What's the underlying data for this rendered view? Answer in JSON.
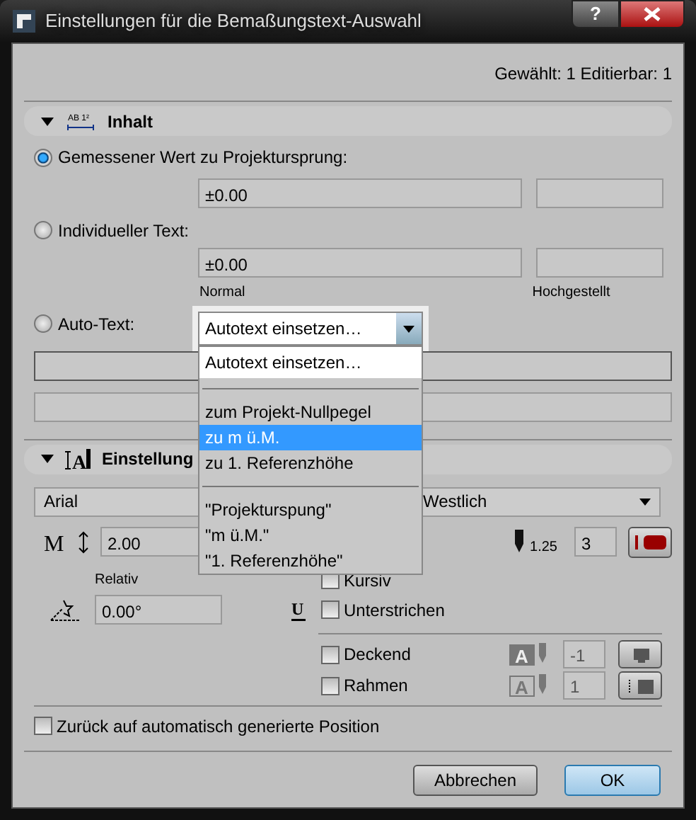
{
  "window": {
    "title": "Einstellungen für die Bemaßungstext-Auswahl",
    "help_button": "?"
  },
  "selection_info": "Gewählt: 1 Editierbar: 1",
  "content_section": {
    "title": "Inhalt",
    "expanded": true,
    "icon_text": "AB 1²"
  },
  "options": [
    {
      "label": "Gemessener Wert zu Projektursprung:",
      "selected": true
    },
    {
      "label": "Individueller Text:",
      "selected": false
    },
    {
      "label": "Auto-Text:",
      "selected": false
    }
  ],
  "measured_field": {
    "value": "±0.00"
  },
  "custom_field": {
    "value": "±0.00"
  },
  "field_labels": [
    "Normal",
    "Hochgestellt"
  ],
  "autotext_select": {
    "value": "Autotext einsetzen…"
  },
  "autotext_menu": [
    {
      "kind": "item",
      "label": "Autotext einsetzen…",
      "selected": false
    },
    {
      "kind": "separator"
    },
    {
      "kind": "item",
      "label": "zum Projekt-Nullpegel",
      "selected": false
    },
    {
      "kind": "item",
      "label": "zu m ü.M.",
      "selected": true
    },
    {
      "kind": "item",
      "label": "zu 1. Referenzhöhe",
      "selected": false
    },
    {
      "kind": "separator"
    },
    {
      "kind": "item",
      "label": "\"Projekturspung\"",
      "selected": false
    },
    {
      "kind": "item",
      "label": "\"m ü.M.\"",
      "selected": false
    },
    {
      "kind": "item",
      "label": "\"1. Referenzhöhe\"",
      "selected": false
    }
  ],
  "settings_section": {
    "title": "Einstellung",
    "expanded": true,
    "icon_text": "A"
  },
  "size_icon_text": "M",
  "underline_icon_text": "U",
  "font": "Arial",
  "script": "Westlich",
  "size": "2.00",
  "size_mode": "Relativ",
  "angle": "0.00°",
  "pen_thickness": "1.25",
  "pen": "3",
  "style_checks": [
    {
      "label": "Kursiv",
      "checked": false
    },
    {
      "label": "Unterstrichen",
      "checked": false
    }
  ],
  "fill_checks": [
    {
      "label": "Deckend",
      "checked": false,
      "pen": "-1",
      "icon_text": "A"
    },
    {
      "label": "Rahmen",
      "checked": false,
      "pen": "1",
      "icon_text": "A"
    }
  ],
  "reset_check": {
    "label": "Zurück auf automatisch generierte Position",
    "checked": false
  },
  "buttons": [
    {
      "label": "Abbrechen",
      "default": false
    },
    {
      "label": "OK",
      "default": true
    }
  ]
}
